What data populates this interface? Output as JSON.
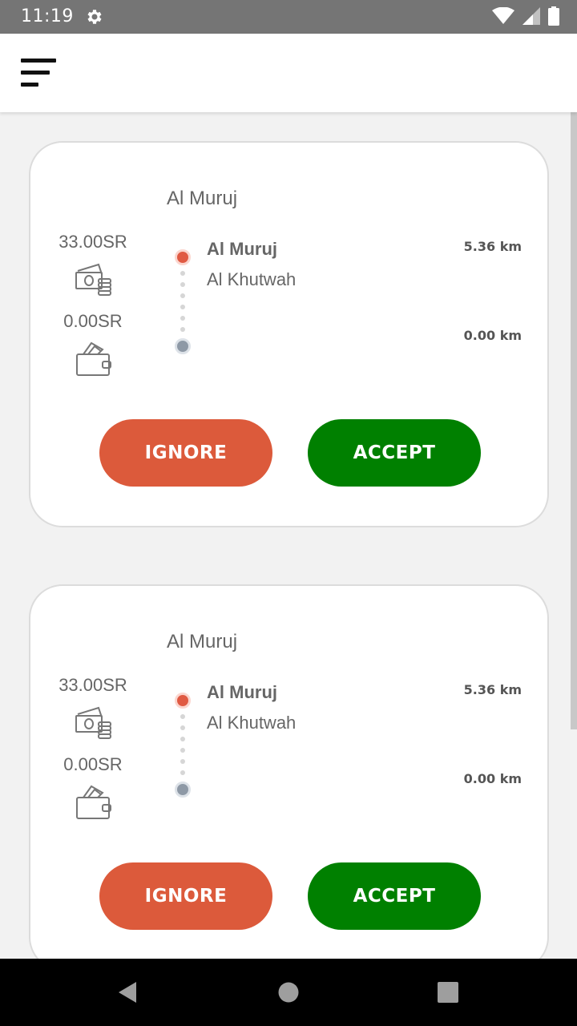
{
  "status_bar": {
    "time": "11:19",
    "icons": [
      "gear-icon",
      "wifi-icon",
      "signal-icon",
      "battery-icon"
    ],
    "color": "#757575"
  },
  "app_bar": {
    "menu_icon": "menu-icon"
  },
  "orders": [
    {
      "area": "Al Muruj",
      "fare": "33.00SR",
      "wallet": "0.00SR",
      "pickup": "Al Muruj",
      "dropoff": "Al Khutwah",
      "pickup_distance": "5.36 km",
      "dropoff_distance": "0.00 km",
      "ignore_label": "IGNORE",
      "accept_label": "ACCEPT"
    },
    {
      "area": "Al Muruj",
      "fare": "33.00SR",
      "wallet": "0.00SR",
      "pickup": "Al Muruj",
      "dropoff": "Al Khutwah",
      "pickup_distance": "5.36 km",
      "dropoff_distance": "0.00 km",
      "ignore_label": "IGNORE",
      "accept_label": "ACCEPT"
    }
  ],
  "colors": {
    "ignore": "#dc5a3b",
    "accept": "#008000",
    "pickup_dot": "#e05a43",
    "dropoff_dot": "#8e99a6"
  },
  "nav_bar": {
    "icons": [
      "back-icon",
      "home-icon",
      "recents-icon"
    ]
  }
}
